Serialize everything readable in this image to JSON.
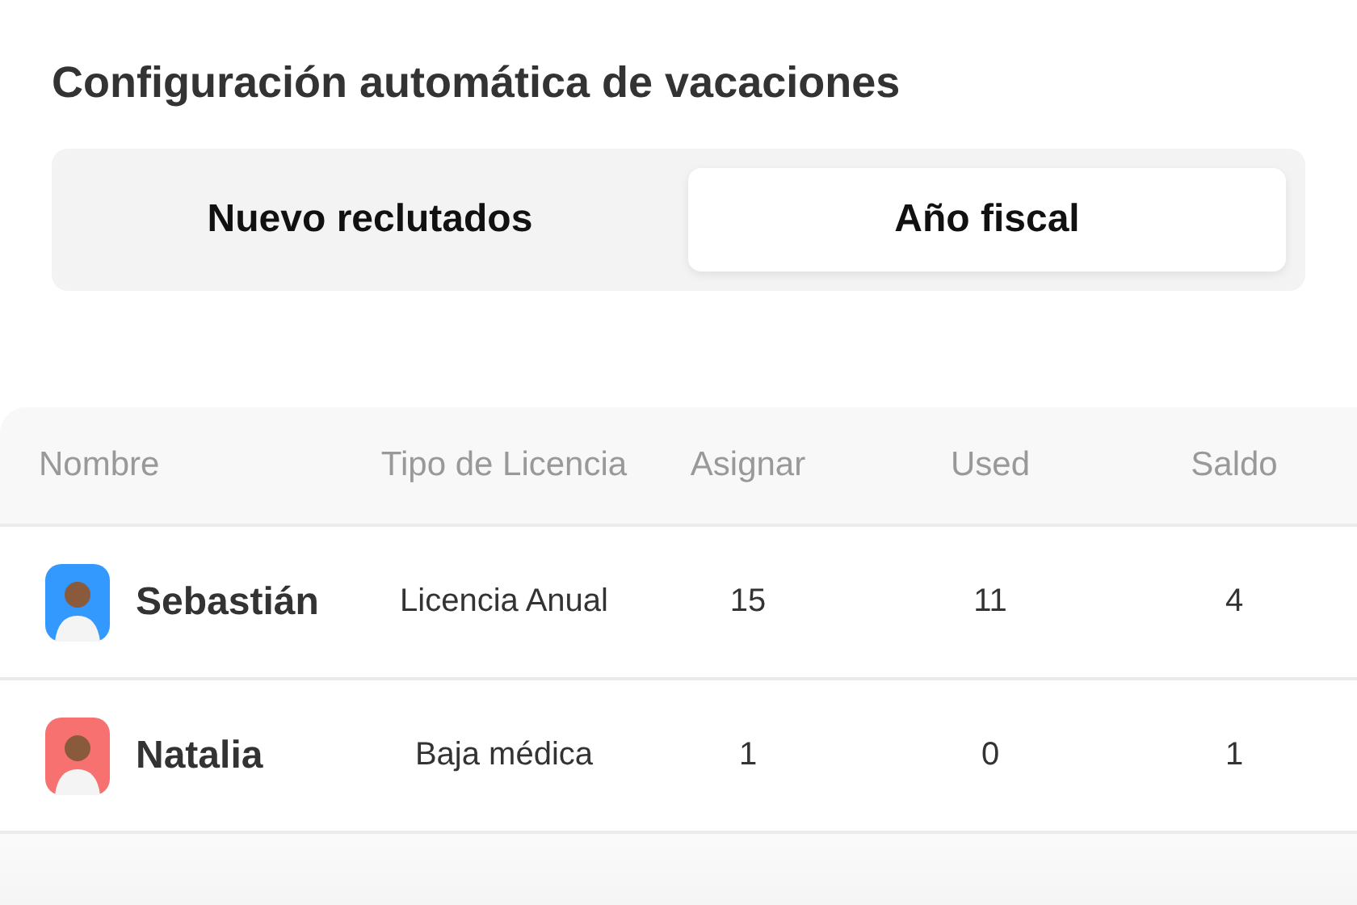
{
  "title": "Configuración automática de vacaciones",
  "tabs": [
    {
      "label": "Nuevo reclutados",
      "selected": false
    },
    {
      "label": "Año fiscal",
      "selected": true
    }
  ],
  "table": {
    "columns": [
      "Nombre",
      "Tipo de Licencia",
      "Asignar",
      "Used",
      "Saldo"
    ],
    "rows": [
      {
        "name": "Sebastián",
        "color": "#3399ff",
        "type": "Licencia Anual",
        "assign": "15",
        "used": "11",
        "balance": "4"
      },
      {
        "name": "Natalia",
        "color": "#f87171",
        "type": "Baja médica",
        "assign": "1",
        "used": "0",
        "balance": "1"
      }
    ]
  }
}
